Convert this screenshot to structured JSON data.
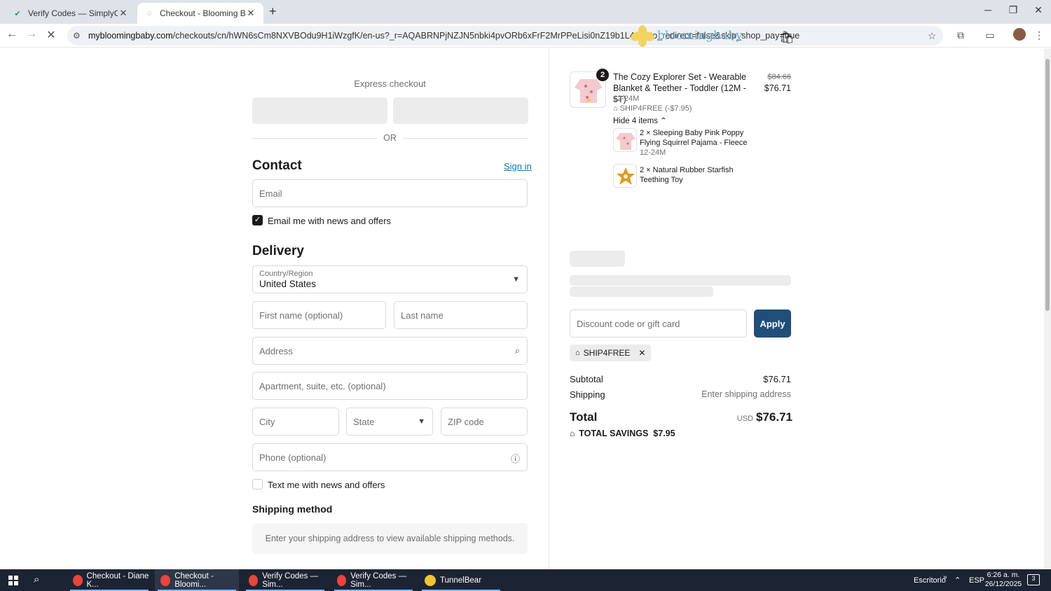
{
  "browser": {
    "tabs": [
      {
        "title": "Verify Codes — SimplyCodes",
        "active": false
      },
      {
        "title": "Checkout - Blooming Baby",
        "active": true
      }
    ],
    "url_domain": "mybloomingbaby.com",
    "url_path": "/checkouts/cn/hWN6sCm8NXVBOdu9H1iWzgfK/en-us?_r=AQABRNPjNZJN5nbki4pvORb6xFrF2MrPPeLisi0nZ19b1L4&auto_redirect=false&skip_shop_pay=true"
  },
  "checkout": {
    "express_title": "Express checkout",
    "or_label": "OR",
    "contact": {
      "heading": "Contact",
      "signin_label": "Sign in",
      "email_placeholder": "Email",
      "news_label": "Email me with news and offers",
      "news_checked": true
    },
    "delivery": {
      "heading": "Delivery",
      "country_label": "Country/Region",
      "country_value": "United States",
      "first_name_placeholder": "First name (optional)",
      "last_name_placeholder": "Last name",
      "address_placeholder": "Address",
      "apartment_placeholder": "Apartment, suite, etc. (optional)",
      "city_placeholder": "City",
      "state_placeholder": "State",
      "zip_placeholder": "ZIP code",
      "phone_placeholder": "Phone (optional)",
      "text_label": "Text me with news and offers",
      "text_checked": false
    },
    "shipping_method": {
      "heading": "Shipping method",
      "message": "Enter your shipping address to view available shipping methods."
    }
  },
  "summary": {
    "brand": "bloomingbaby",
    "item": {
      "quantity": "2",
      "name": "The Cozy Explorer Set - Wearable Blanket & Teether - Toddler (12M - 5T)",
      "variant": "12-24M",
      "discount": "SHIP4FREE (-$7.95)",
      "toggle": "Hide 4 items",
      "price_original": "$84.66",
      "price": "$76.71"
    },
    "sub_items": [
      {
        "name": "2 × Sleeping Baby Pink Poppy Flying Squirrel Pajama - Fleece",
        "variant": "12-24M"
      },
      {
        "name": "2 × Natural Rubber Starfish Teething Toy",
        "variant": ""
      }
    ],
    "discount_placeholder": "Discount code or gift card",
    "apply_label": "Apply",
    "applied_code": "SHIP4FREE",
    "subtotal_label": "Subtotal",
    "subtotal_value": "$76.71",
    "shipping_label": "Shipping",
    "shipping_value": "Enter shipping address",
    "total_label": "Total",
    "total_currency": "USD",
    "total_value": "$76.71",
    "savings_label": "TOTAL SAVINGS",
    "savings_value": "$7.95"
  },
  "taskbar": {
    "apps": [
      {
        "label": "Checkout - Diane K..."
      },
      {
        "label": "Checkout - Bloomi..."
      },
      {
        "label": "Verify Codes — Sim..."
      },
      {
        "label": "Verify Codes — Sim..."
      },
      {
        "label": "TunnelBear"
      }
    ],
    "desktop_label": "Escritorio",
    "lang": "ESP",
    "time": "6:26 a. m.",
    "date": "26/12/2025",
    "notif_count": "3"
  }
}
